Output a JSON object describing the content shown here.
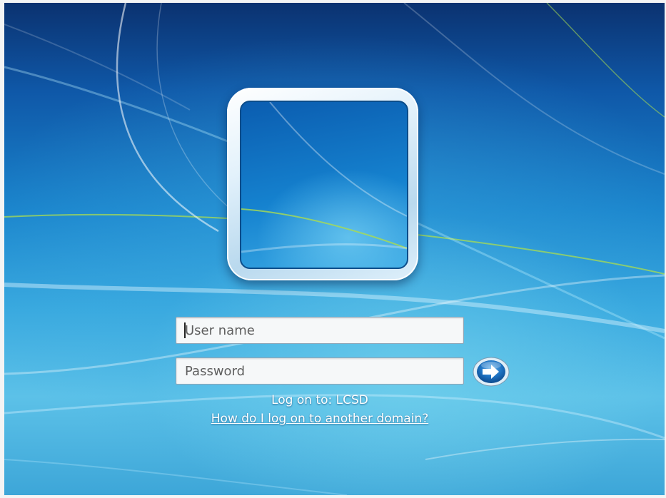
{
  "user_tile": {
    "icon": "user-picture-icon"
  },
  "login_form": {
    "username_placeholder": "User name",
    "password_placeholder": "Password",
    "submit_icon": "arrow-right-icon"
  },
  "domain_info": {
    "logon_to": "Log on to: LCSD",
    "help_link": "How do I log on to another domain?"
  },
  "colors": {
    "background_top": "#0b3270",
    "background_bottom": "#5cc1e8",
    "text": "#ffffff",
    "button": "#1f74c4"
  }
}
